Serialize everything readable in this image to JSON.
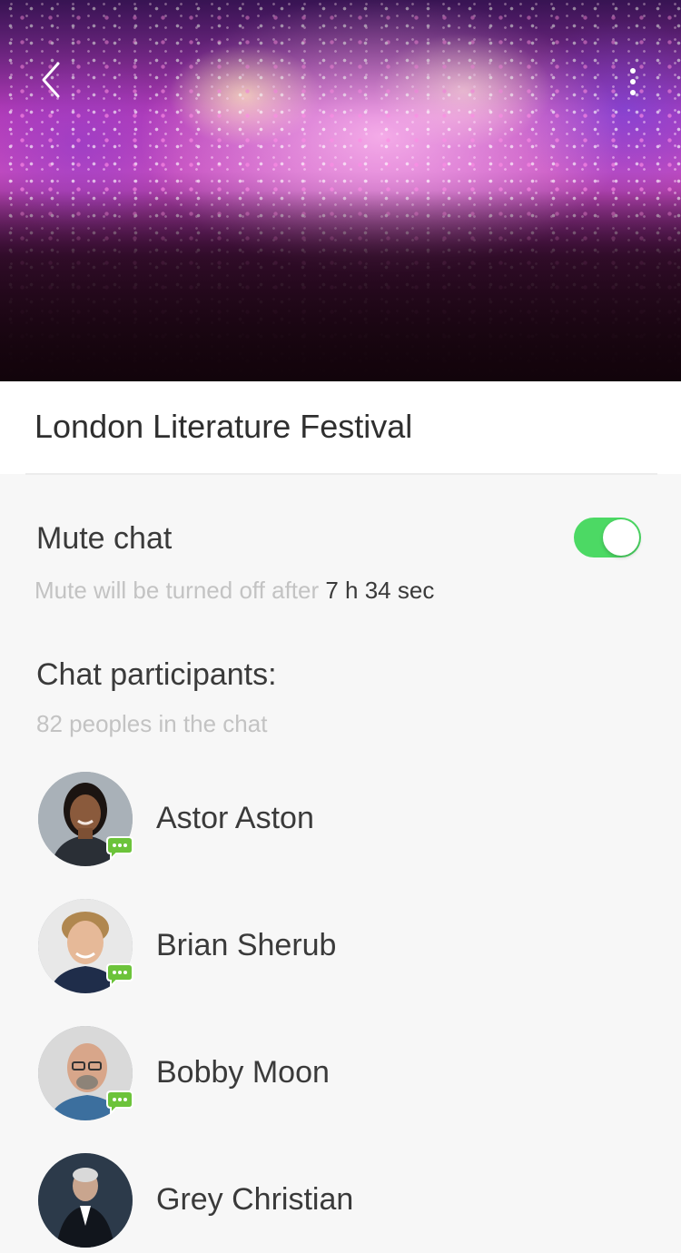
{
  "header": {
    "title": "London Literature Festival"
  },
  "mute": {
    "label": "Mute chat",
    "enabled": true,
    "note_prefix": "Mute will be turned off after ",
    "note_time": "7 h 34 sec"
  },
  "participants": {
    "title": "Chat participants:",
    "count_text": "82 peoples in the chat",
    "list": [
      {
        "name": "Astor Aston"
      },
      {
        "name": "Brian Sherub"
      },
      {
        "name": "Bobby Moon"
      },
      {
        "name": "Grey Christian"
      }
    ]
  },
  "colors": {
    "toggle_on": "#4cd964",
    "chat_badge": "#6cc33a",
    "muted_text": "#c3c3c3",
    "primary_text": "#3a3a3a"
  },
  "icons": {
    "back": "chevron-left-icon",
    "more": "more-vertical-icon",
    "chat_badge": "chat-bubble-icon"
  }
}
